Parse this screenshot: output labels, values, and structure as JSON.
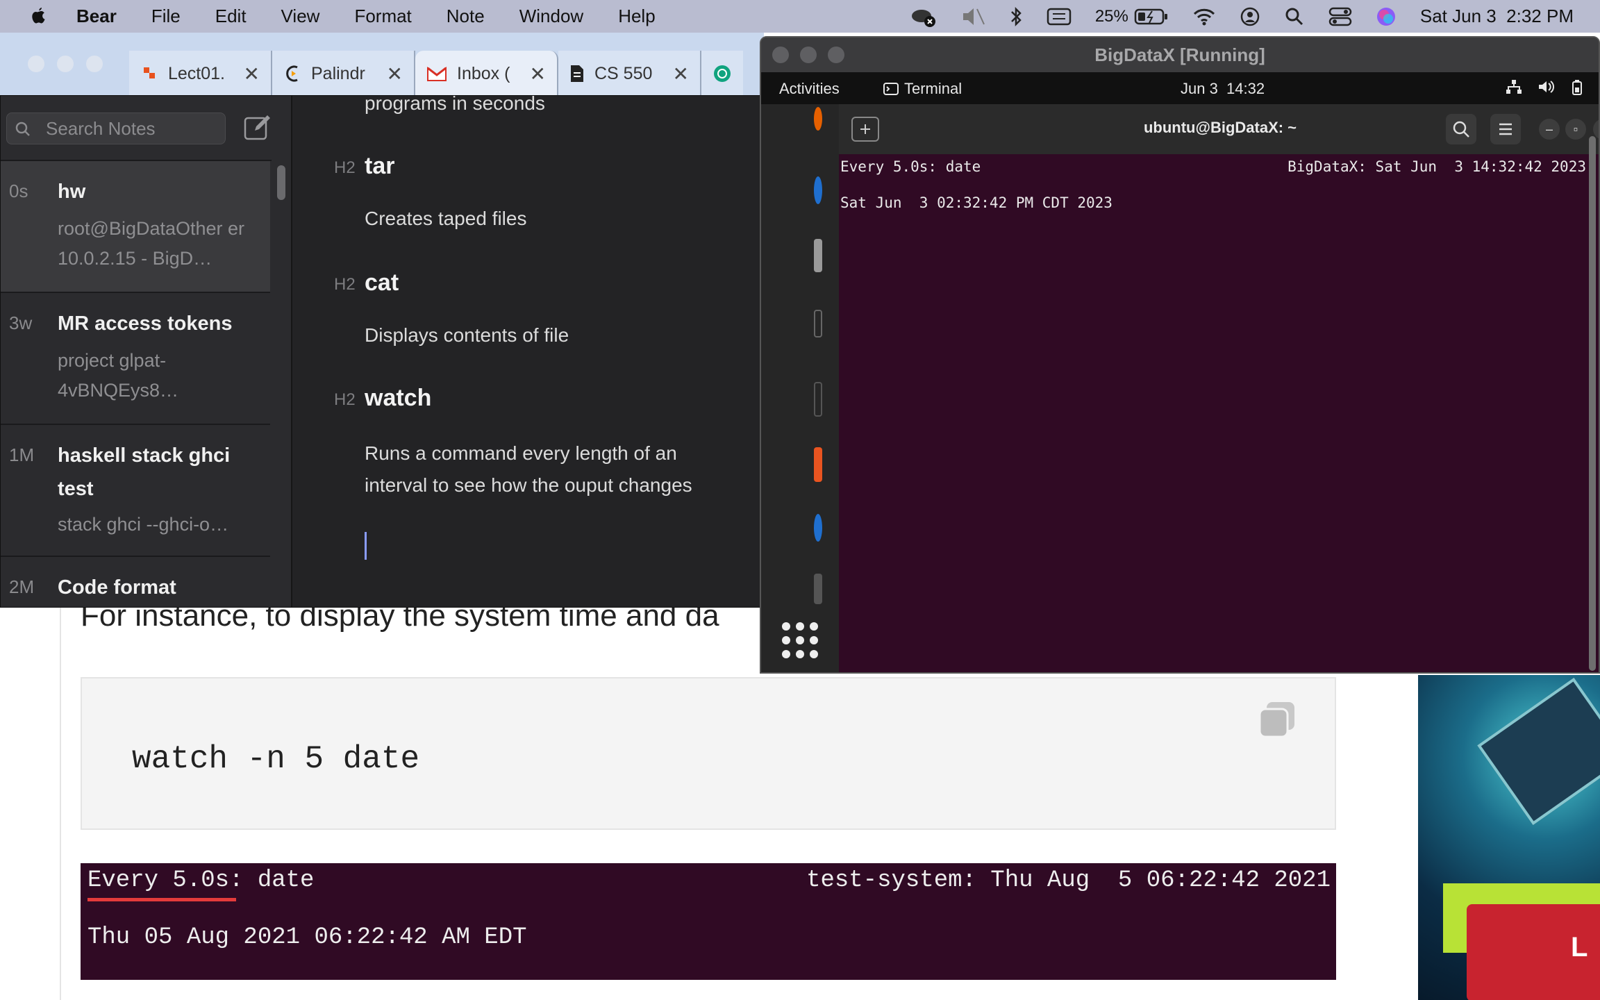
{
  "menubar": {
    "app": "Bear",
    "items": [
      "File",
      "Edit",
      "View",
      "Format",
      "Note",
      "Window",
      "Help"
    ],
    "battery": "25%",
    "datetime": "Sat Jun 3  2:32 PM"
  },
  "browser": {
    "tabs": [
      {
        "label": "Lect01.",
        "icon": "lecture-icon"
      },
      {
        "label": "Palindr",
        "icon": "palindrome-site-icon"
      },
      {
        "label": "Inbox (",
        "icon": "gmail-icon"
      },
      {
        "label": "CS 550",
        "icon": "document-icon"
      }
    ],
    "article": {
      "text": "For instance, to display the system time and da",
      "code": "watch -n 5 date",
      "example_line1": "Every 5.0s: date",
      "example_right": "test-system: Thu Aug  5 06:22:42 2021",
      "example_line2": "Thu 05 Aug 2021 06:22:42 AM EDT",
      "ad_letter": "L"
    }
  },
  "bear": {
    "search_placeholder": "Search Notes",
    "notes": [
      {
        "age": "0s",
        "title": "hw",
        "preview": "root@BigDataOther er 10.0.2.15 - BigD…"
      },
      {
        "age": "3w",
        "title": "MR access tokens",
        "preview": "project glpat-4vBNQEys8…"
      },
      {
        "age": "1M",
        "title": "haskell stack ghci test",
        "preview": "stack ghci --ghci-o…"
      },
      {
        "age": "2M",
        "title": "Code format",
        "preview": ""
      }
    ],
    "editor": {
      "top_text": "programs in seconds",
      "h2_marker": "H2",
      "sections": [
        {
          "heading": "tar",
          "body": "Creates taped files"
        },
        {
          "heading": "cat",
          "body": "Displays contents of file"
        },
        {
          "heading": "watch",
          "body_line1": "Runs a command every length of an",
          "body_line2": "interval to see how the ouput changes"
        }
      ]
    }
  },
  "vbox": {
    "title": "BigDataX [Running]",
    "ubuntu": {
      "activities": "Activities",
      "app": "Terminal",
      "clock": "Jun 3  14:32"
    },
    "terminal": {
      "title": "ubuntu@BigDataX: ~",
      "line1": "Every 5.0s: date",
      "right": "BigDataX: Sat Jun  3 14:32:42 2023",
      "line2": "Sat Jun  3 02:32:42 PM CDT 2023"
    }
  }
}
